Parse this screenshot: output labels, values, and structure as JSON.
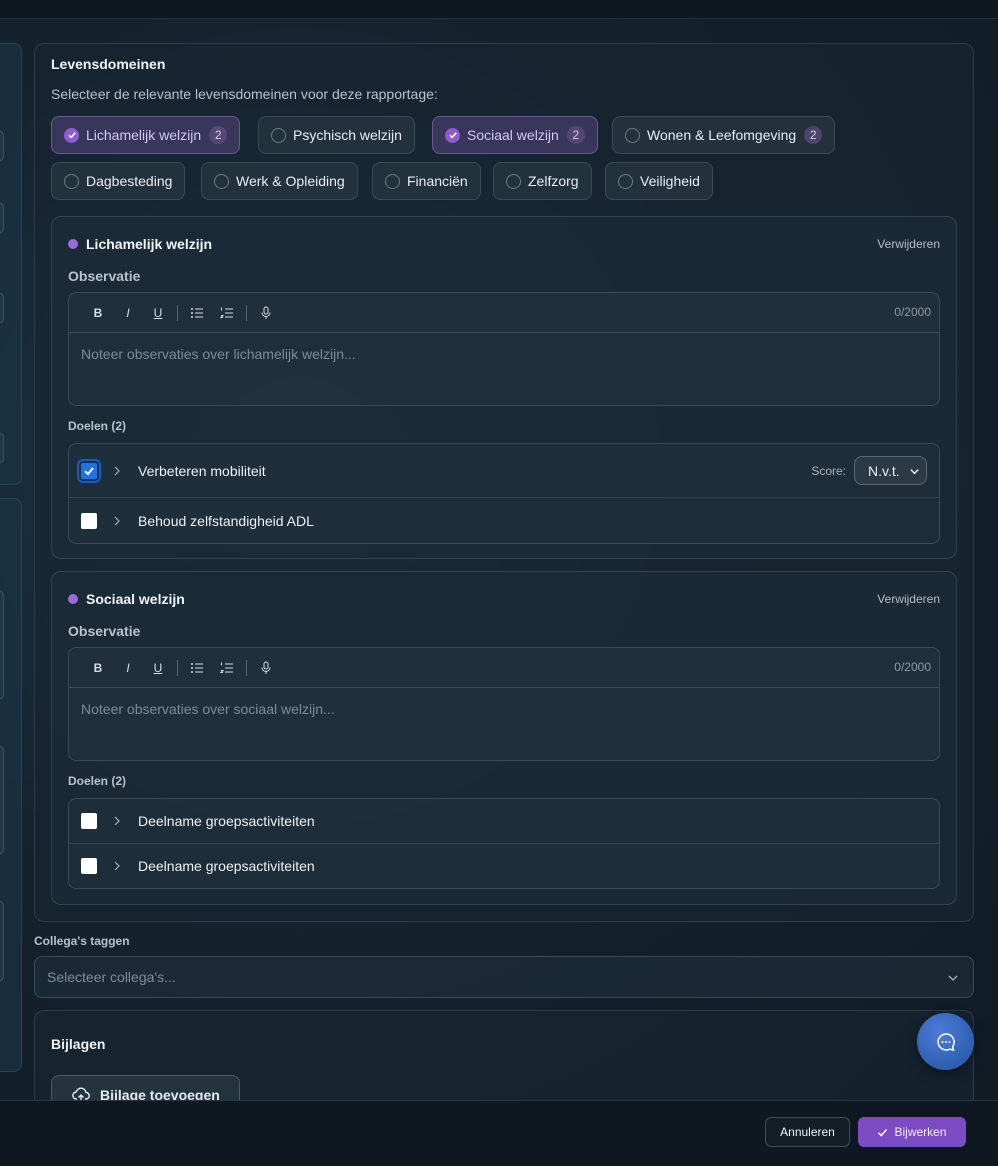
{
  "domains": {
    "title": "Levensdomeinen",
    "subtitle": "Selecteer de relevante levensdomeinen voor deze rapportage:",
    "chips": [
      {
        "label": "Lichamelijk welzijn",
        "selected": true,
        "count": "2"
      },
      {
        "label": "Psychisch welzijn",
        "selected": false,
        "count": ""
      },
      {
        "label": "Sociaal welzijn",
        "selected": true,
        "count": "2"
      },
      {
        "label": "Wonen & Leefomgeving",
        "selected": false,
        "count": "2"
      },
      {
        "label": "Dagbesteding",
        "selected": false,
        "count": ""
      },
      {
        "label": "Werk & Opleiding",
        "selected": false,
        "count": ""
      },
      {
        "label": "Financiën",
        "selected": false,
        "count": ""
      },
      {
        "label": "Zelfzorg",
        "selected": false,
        "count": ""
      },
      {
        "label": "Veiligheid",
        "selected": false,
        "count": ""
      }
    ]
  },
  "cards": [
    {
      "title": "Lichamelijk welzijn",
      "remove_label": "Verwijderen",
      "observation_label": "Observatie",
      "counter": "0/2000",
      "placeholder": "Noteer observaties over lichamelijk welzijn...",
      "goals_label": "Doelen (2)",
      "goals": [
        {
          "name": "Verbeteren mobiliteit",
          "checked": true,
          "score_label": "Score:",
          "score_value": "N.v.t."
        },
        {
          "name": "Behoud zelfstandigheid ADL",
          "checked": false
        }
      ]
    },
    {
      "title": "Sociaal welzijn",
      "remove_label": "Verwijderen",
      "observation_label": "Observatie",
      "counter": "0/2000",
      "placeholder": "Noteer observaties over sociaal welzijn...",
      "goals_label": "Doelen (2)",
      "goals": [
        {
          "name": "Deelname groepsactiviteiten",
          "checked": false
        },
        {
          "name": "Deelname groepsactiviteiten",
          "checked": false
        }
      ]
    }
  ],
  "toolbar": {
    "bold": "B",
    "italic": "I",
    "underline": "U"
  },
  "collega": {
    "label": "Collega's taggen",
    "placeholder": "Selecteer collega's..."
  },
  "bijlagen": {
    "title": "Bijlagen",
    "add_label": "Bijlage toevoegen"
  },
  "footer": {
    "cancel_label": "Annuleren",
    "save_label": "Bijwerken"
  },
  "colors": {
    "accent": "#7c4bc4",
    "chip_selected": "#8e5bd0",
    "fab": "#2d5fb0"
  },
  "icons": [
    "check-icon",
    "bold-icon",
    "italic-icon",
    "underline-icon",
    "bullet-list-icon",
    "numbered-list-icon",
    "microphone-icon",
    "chevron-right-icon",
    "chevron-down-icon",
    "upload-cloud-icon",
    "chat-icon"
  ]
}
